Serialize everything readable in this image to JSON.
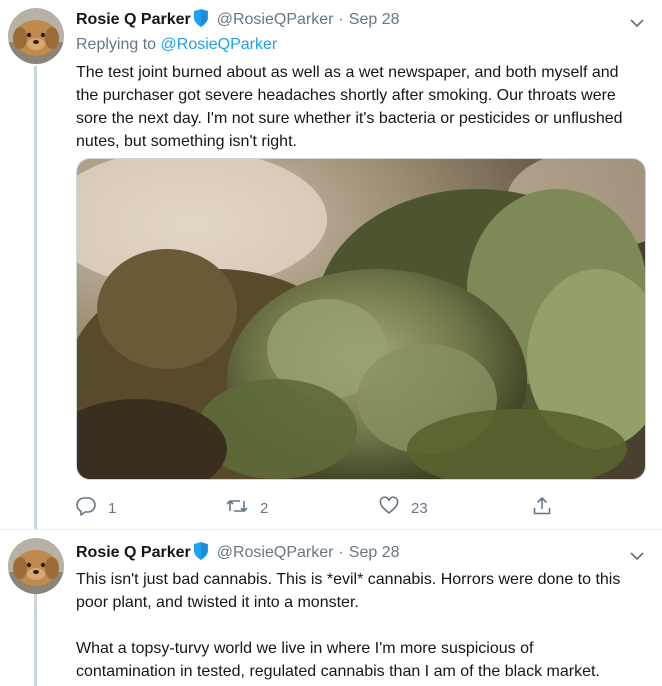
{
  "tweets": [
    {
      "author": {
        "name": "Rosie Q Parker",
        "handle": "@RosieQParker"
      },
      "separator": "·",
      "date": "Sep 28",
      "replying_prefix": "Replying to",
      "replying_handle": "@RosieQParker",
      "text": "The test joint burned about as well as a wet newspaper, and both myself and the purchaser got severe headaches shortly after smoking. Our throats were sore the next day. I'm not sure whether it's bacteria or pesticides or unflushed nutes, but something isn't right.",
      "stats": {
        "replies": "1",
        "retweets": "2",
        "likes": "23"
      }
    },
    {
      "author": {
        "name": "Rosie Q Parker",
        "handle": "@RosieQParker"
      },
      "separator": "·",
      "date": "Sep 28",
      "text": "This isn't just bad cannabis. This is *evil* cannabis. Horrors were done to this poor plant, and twisted it into a monster.\n\nWhat a topsy-turvy world we live in where I'm more suspicious of contamination in tested, regulated cannabis than I am of the black market."
    }
  ],
  "icons": {
    "verified": "verified-badge-icon",
    "caret": "chevron-down-icon",
    "reply": "reply-icon",
    "retweet": "retweet-icon",
    "like": "heart-icon",
    "share": "share-icon"
  },
  "colors": {
    "link": "#1da1f2",
    "secondary_text": "#657786",
    "verified": "#1da1f2",
    "thread_line": "#ccd6dd"
  }
}
